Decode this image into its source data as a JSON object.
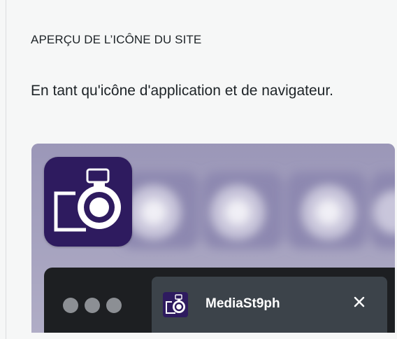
{
  "section": {
    "title": "APERÇU DE L’ICÔNE DU SITE",
    "description": "En tant qu'icône d'application et de navigateur."
  },
  "preview": {
    "app_icon": "camera-icon",
    "browser": {
      "controls": [
        "window-dot",
        "window-dot",
        "window-dot"
      ],
      "tab": {
        "favicon": "camera-icon",
        "title": "MediaSt9ph",
        "close_icon": "close-icon"
      }
    }
  },
  "colors": {
    "icon_background": "#2e1b5f",
    "preview_background": "#a9a5c2",
    "browser_bar": "#1d1f22",
    "tab_background": "#3c434a"
  }
}
